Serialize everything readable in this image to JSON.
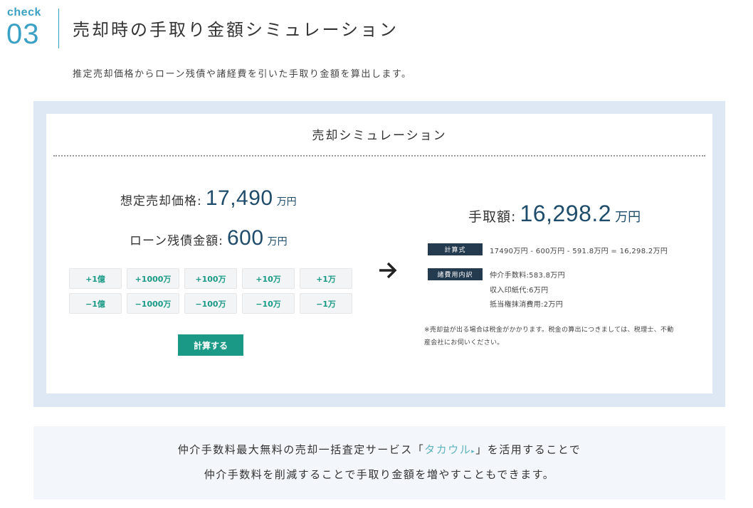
{
  "header": {
    "check_label": "check",
    "check_number": "03",
    "title": "売却時の手取り金額シミュレーション",
    "subtitle": "推定売却価格からローン残債や諸経費を引いた手取り金額を算出します。"
  },
  "simulator": {
    "title": "売却シミュレーション",
    "price_label": "想定売却価格:",
    "price_value": "17,490",
    "price_unit": "万円",
    "loan_label": "ローン残債金額:",
    "loan_value": "600",
    "loan_unit": "万円",
    "plus_buttons": [
      "+1億",
      "+1000万",
      "+100万",
      "+10万",
      "+1万"
    ],
    "minus_buttons": [
      "−1億",
      "−1000万",
      "−100万",
      "−10万",
      "−1万"
    ],
    "calc_button": "計算する"
  },
  "result": {
    "takehome_label": "手取額:",
    "takehome_value": "16,298.2",
    "takehome_unit": "万円",
    "formula_tag": "計算式",
    "formula": "17490万円 - 600万円 - 591.8万円 = 16,298.2万円",
    "costs_tag": "諸費用内訳",
    "costs": [
      "仲介手数料:583.8万円",
      "収入印紙代:6万円",
      "抵当権抹消費用:2万円"
    ],
    "note_line1": "※売却益が出る場合は税金がかかります。税金の算出につきましては、税理士、不動",
    "note_line2": "産会社にお伺いください。"
  },
  "bottom": {
    "line1_before": "仲介手数料最大無料の売却一括査定サービス「",
    "link_text": "タカウル",
    "link_marker": "▸",
    "line1_after": "」を活用することで",
    "line2": "仲介手数料を削減することで手取り金額を増やすこともできます。"
  },
  "colors": {
    "accent_teal": "#1a9a86",
    "heading_blue": "#3aa0c4",
    "number_navy": "#1f4c6b",
    "tag_navy": "#233a4f",
    "panel_bg": "#dde8f4"
  },
  "icons": {
    "arrow": "arrow-right-icon"
  }
}
